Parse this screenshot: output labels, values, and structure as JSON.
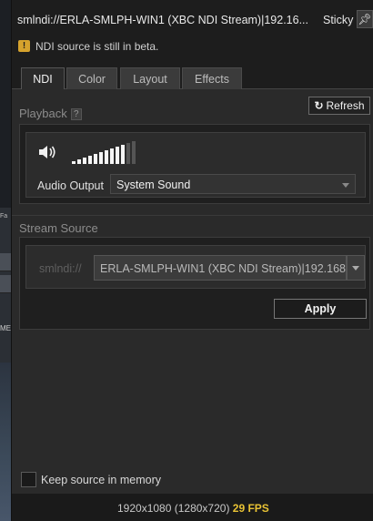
{
  "window": {
    "title": "smlndi://ERLA-SMLPH-WIN1 (XBC NDI Stream)|192.16...",
    "sticky_label": "Sticky"
  },
  "warning": {
    "icon": "warning-icon",
    "text": "NDI source is still in beta."
  },
  "tabs": [
    {
      "label": "NDI",
      "active": true
    },
    {
      "label": "Color",
      "active": false
    },
    {
      "label": "Layout",
      "active": false
    },
    {
      "label": "Effects",
      "active": false
    }
  ],
  "playback": {
    "section_label": "Playback",
    "help": "?",
    "refresh_label": "Refresh",
    "volume_level": 0.85,
    "audio_output_label": "Audio Output",
    "audio_output_value": "System Sound"
  },
  "stream_source": {
    "section_label": "Stream Source",
    "prefix": "smlndi://",
    "value": "ERLA-SMLPH-WIN1 (XBC NDI Stream)|192.168",
    "apply_label": "Apply"
  },
  "keep_source": {
    "label": "Keep source in memory",
    "checked": false
  },
  "status": {
    "resolution": "1920x1080 (1280x720)",
    "fps": "29 FPS"
  },
  "background": {
    "fragment_label_1": "Fa",
    "fragment_label_2": "ME"
  },
  "colors": {
    "accent_fps": "#e8c234",
    "warning": "#d5a22d"
  }
}
